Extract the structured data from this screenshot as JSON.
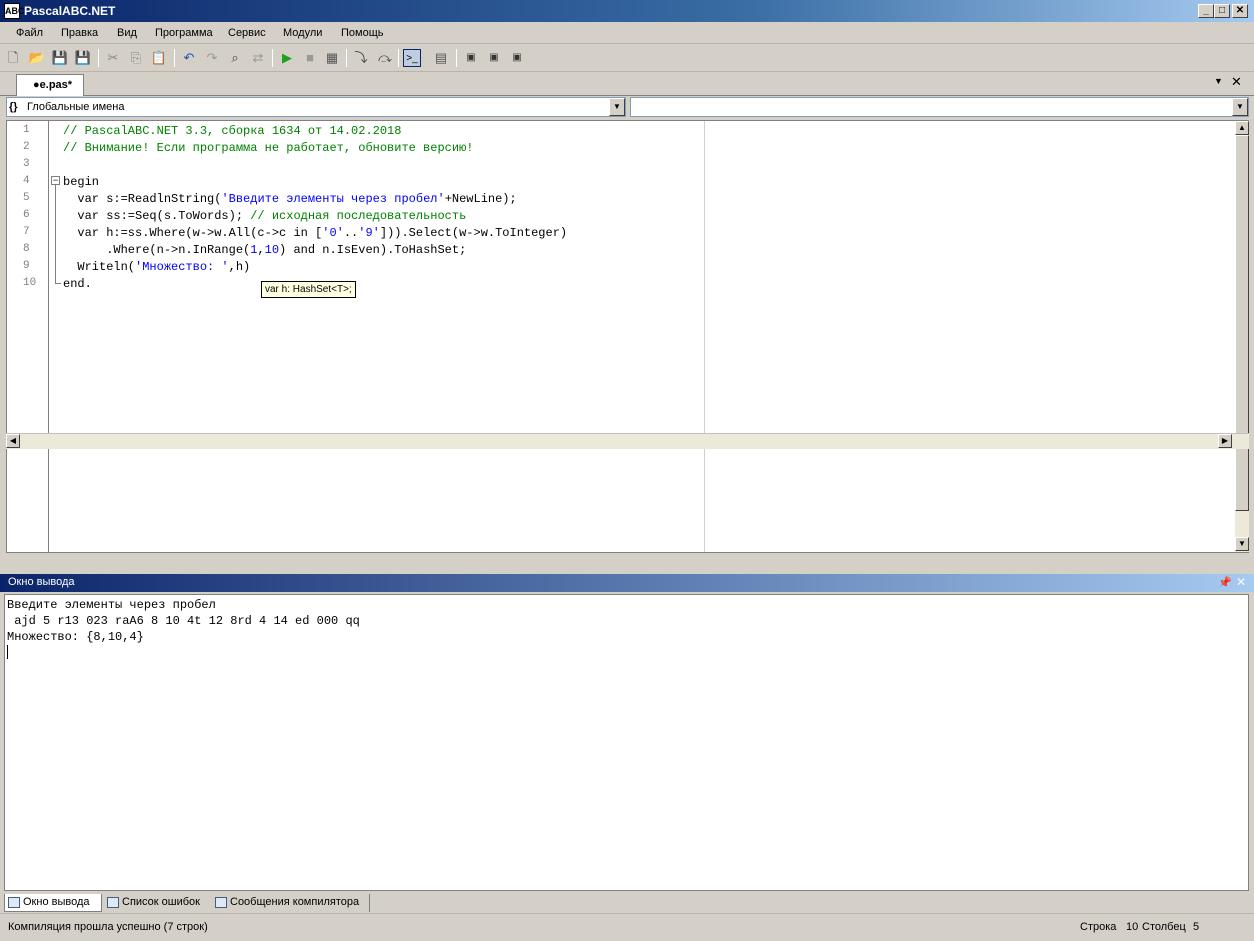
{
  "window": {
    "title": "PascalABC.NET",
    "logo": "ABC"
  },
  "menu": [
    "Файл",
    "Правка",
    "Вид",
    "Программа",
    "Сервис",
    "Модули",
    "Помощь"
  ],
  "tab": {
    "label": "●e.pas*"
  },
  "combos": {
    "left_value": "Глобальные имена",
    "left_icon": "{}",
    "right_value": ""
  },
  "editor": {
    "line_numbers": [
      "1",
      "2",
      "3",
      "4",
      "5",
      "6",
      "7",
      "8",
      "9",
      "10"
    ],
    "lines": [
      [
        {
          "t": "// PascalABC.NET 3.3, сборка 1634 от 14.02.2018",
          "c": "cm"
        }
      ],
      [
        {
          "t": "// Внимание! Если программа не работает, обновите версию!",
          "c": "cm"
        }
      ],
      [
        {
          "t": "",
          "c": ""
        }
      ],
      [
        {
          "t": "begin",
          "c": ""
        }
      ],
      [
        {
          "t": "  var s:=ReadlnString(",
          "c": ""
        },
        {
          "t": "'Введите элементы через пробел'",
          "c": "st"
        },
        {
          "t": "+NewLine);",
          "c": ""
        }
      ],
      [
        {
          "t": "  var ss:=Seq(s.ToWords); ",
          "c": ""
        },
        {
          "t": "// исходная последовательность",
          "c": "cm"
        }
      ],
      [
        {
          "t": "  var h:=ss.Where(w->w.All(c->c in [",
          "c": ""
        },
        {
          "t": "'0'",
          "c": "st"
        },
        {
          "t": "..",
          "c": ""
        },
        {
          "t": "'9'",
          "c": "st"
        },
        {
          "t": "])).Select(w->w.ToInteger)",
          "c": ""
        }
      ],
      [
        {
          "t": "      .Where(n->n.InRange(",
          "c": ""
        },
        {
          "t": "1",
          "c": "nm"
        },
        {
          "t": ",",
          "c": ""
        },
        {
          "t": "10",
          "c": "nm"
        },
        {
          "t": ") and n.IsEven).ToHashSet;",
          "c": ""
        }
      ],
      [
        {
          "t": "  Writeln(",
          "c": ""
        },
        {
          "t": "'Множество: '",
          "c": "st"
        },
        {
          "t": ",h)",
          "c": ""
        }
      ],
      [
        {
          "t": "end.",
          "c": ""
        }
      ]
    ],
    "tooltip": "var h: HashSet<T>;"
  },
  "output_panel": {
    "title": "Окно вывода",
    "lines": [
      "Введите элементы через пробел",
      " ajd 5 r13 023 raA6 8 10 4t 12 8rd 4 14 ed 000 qq",
      "Множество: {8,10,4}"
    ]
  },
  "bottom_tabs": [
    "Окно вывода",
    "Список ошибок",
    "Сообщения компилятора"
  ],
  "status": {
    "message": "Компиляция прошла успешно (7 строк)",
    "row_label": "Строка",
    "row_value": "10",
    "col_label": "Столбец",
    "col_value": "5"
  }
}
